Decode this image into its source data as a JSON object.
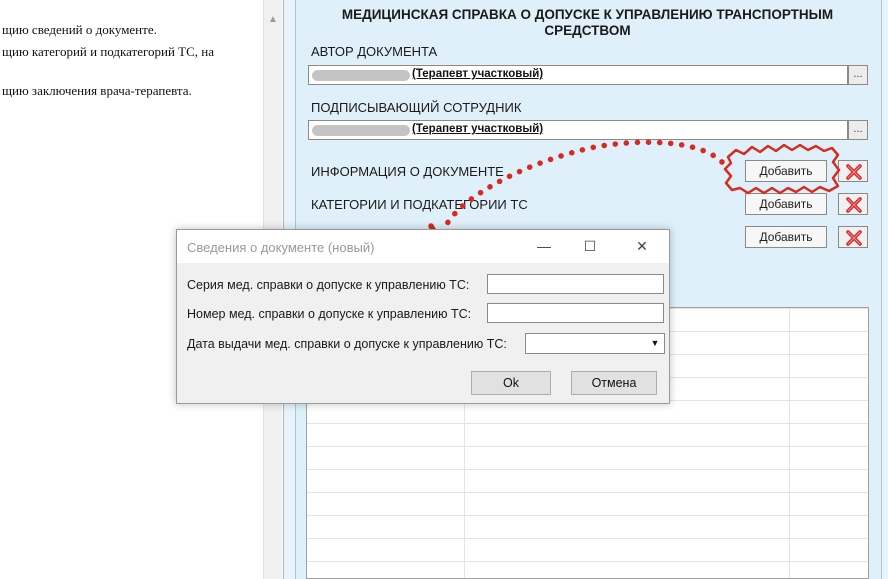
{
  "document_text": {
    "lines": [
      "щию сведений о документе.",
      "щию категорий и подкатегорий ТС, на",
      "щию заключения врача-терапевта."
    ]
  },
  "form": {
    "title": "МЕДИЦИНСКАЯ СПРАВКА О ДОПУСКЕ К УПРАВЛЕНИЮ ТРАНСПОРТНЫМ СРЕДСТВОМ",
    "author_label": "АВТОР ДОКУМЕНТА",
    "author_value": "(Терапевт участковый)",
    "signer_label": "ПОДПИСЫВАЮЩИЙ СОТРУДНИК",
    "signer_value": "(Терапевт участковый)",
    "ellipsis_label": "...",
    "sections": [
      {
        "label": "ИНФОРМАЦИЯ О ДОКУМЕНТЕ",
        "add_label": "Добавить"
      },
      {
        "label": "КАТЕГОРИИ И ПОДКАТЕГОРИИ ТС",
        "add_label": "Добавить"
      },
      {
        "label": "",
        "add_label": "Добавить"
      }
    ]
  },
  "dialog": {
    "title": "Сведения о документе (новый)",
    "minimize": "—",
    "maximize": "☐",
    "close": "✕",
    "fields": [
      {
        "label": "Серия мед. справки о допуске к управлению ТС:",
        "value": ""
      },
      {
        "label": "Номер мед. справки о допуске к управлению ТС:",
        "value": ""
      },
      {
        "label": "Дата выдачи мед. справки о допуске к управлению ТС:",
        "value": ""
      }
    ],
    "ok_label": "Ok",
    "cancel_label": "Отмена"
  },
  "colors": {
    "annotation": "#d62b1e",
    "panel_bg": "#dff0fb"
  },
  "icons": {
    "delete": "red-x-icon",
    "dropdown": "chevron-down-icon"
  }
}
